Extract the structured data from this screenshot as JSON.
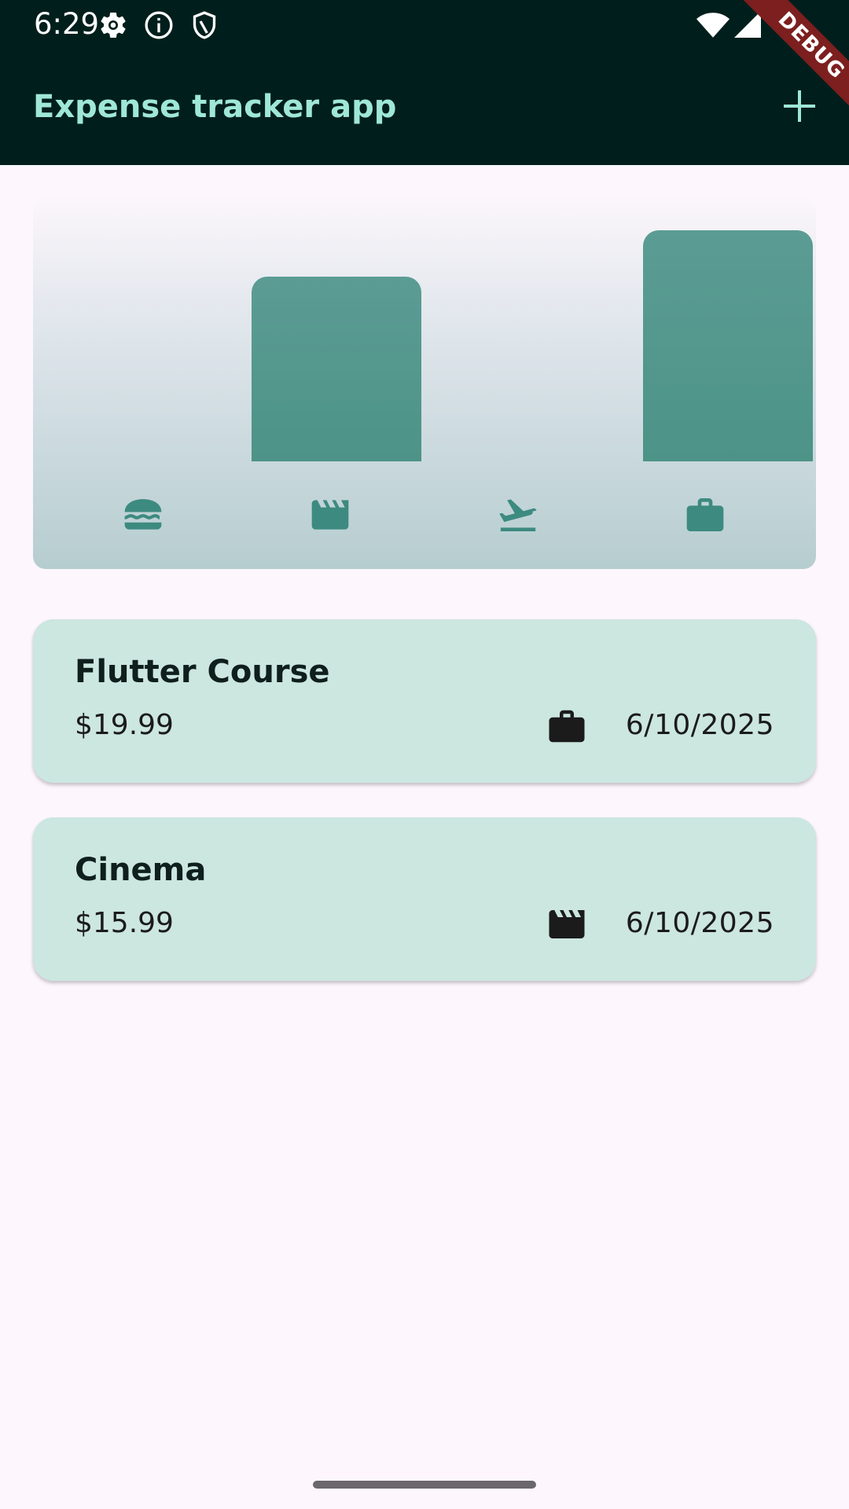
{
  "status_bar": {
    "time": "6:29",
    "icons": [
      "settings-icon",
      "info-icon",
      "shield-icon",
      "wifi-icon",
      "cellular-signal-icon"
    ]
  },
  "debug_banner": {
    "label": "DEBUG"
  },
  "app_bar": {
    "title": "Expense tracker app",
    "add_icon": "add-icon"
  },
  "chart": {
    "categories": [
      {
        "name": "food",
        "icon": "hamburger-icon",
        "value": 0
      },
      {
        "name": "leisure",
        "icon": "movie-clapperboard-icon",
        "value": 15.99
      },
      {
        "name": "travel",
        "icon": "flight-takeoff-icon",
        "value": 0
      },
      {
        "name": "work",
        "icon": "briefcase-icon",
        "value": 19.99
      }
    ]
  },
  "chart_data": {
    "type": "bar",
    "categories": [
      "food",
      "leisure",
      "travel",
      "work"
    ],
    "values": [
      0,
      15.99,
      0,
      19.99
    ],
    "title": "",
    "xlabel": "",
    "ylabel": ""
  },
  "expenses": [
    {
      "title": "Flutter Course",
      "amount": "$19.99",
      "category_icon": "briefcase-icon",
      "date": "6/10/2025"
    },
    {
      "title": "Cinema",
      "amount": "$15.99",
      "category_icon": "movie-clapperboard-icon",
      "date": "6/10/2025"
    }
  ],
  "colors": {
    "app_bar_bg": "#001f1c",
    "app_bar_title": "#9fe7d6",
    "bar": "#55998f",
    "icon_teal": "#3d8a80",
    "card_bg": "#cce6e0",
    "page_bg": "#fdf6fd",
    "debug_banner": "#7d1f1f"
  }
}
